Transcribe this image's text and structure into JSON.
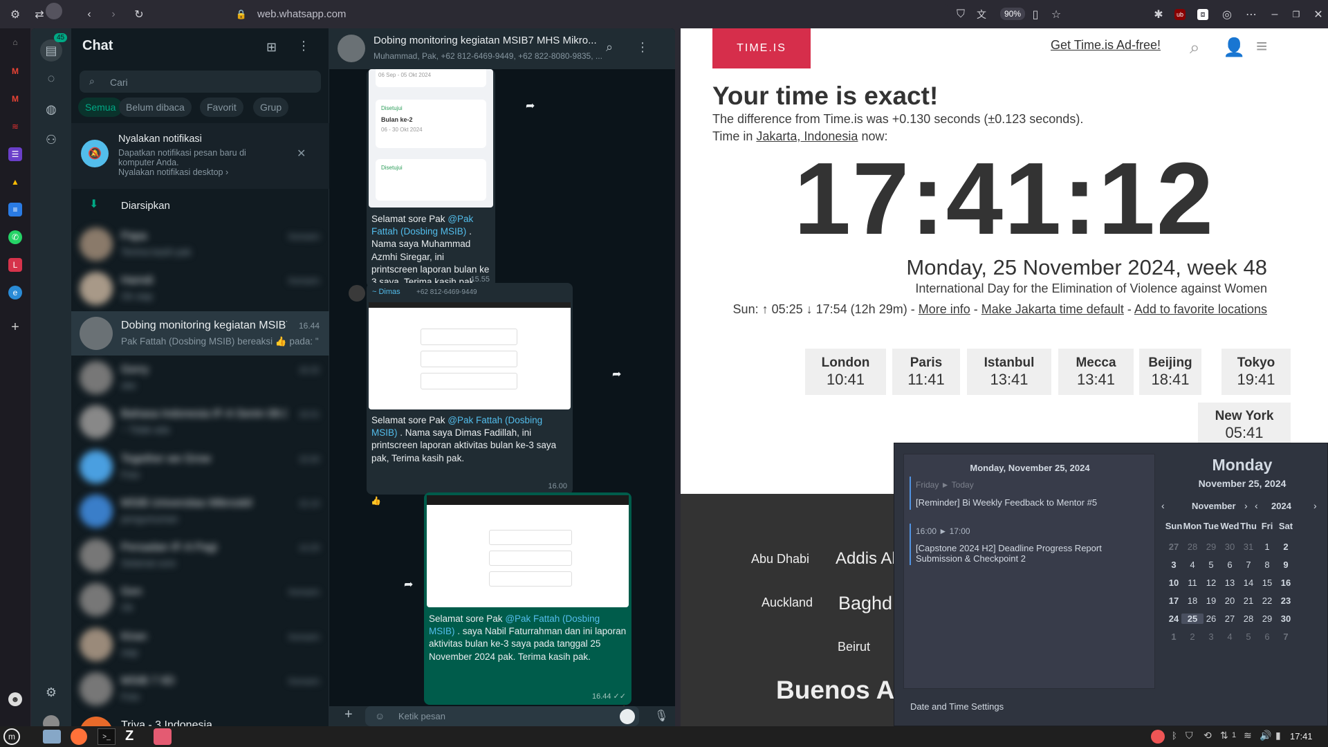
{
  "browser": {
    "url": "web.whatsapp.com",
    "zoom": "90%",
    "ublock": "ub"
  },
  "whatsapp": {
    "unread_badge": "45",
    "title": "Chat",
    "search_placeholder": "Cari",
    "filters": [
      "Semua",
      "Belum dibaca",
      "Favorit",
      "Grup"
    ],
    "notif": {
      "title": "Nyalakan notifikasi",
      "body": "Dapatkan notifikasi pesan baru di komputer Anda.",
      "link": "Nyalakan notifikasi desktop ›"
    },
    "archived": "Diarsipkan",
    "chats": [
      {
        "name": "Papa",
        "preview": "Terima kasih pak",
        "time": "Kemarin",
        "blurred": true
      },
      {
        "name": "Hamdi",
        "preview": "Ok siap",
        "time": "Kemarin",
        "blurred": true
      },
      {
        "name": "Dobing monitoring kegiatan MSIB7 ...",
        "preview": "Pak Fattah (Dosbing MSIB) bereaksi 👍 pada: \"📷 S",
        "time": "16.44",
        "blurred": false
      },
      {
        "name": "Gerry",
        "preview": "oke",
        "time": "16.32",
        "blurred": true
      },
      {
        "name": "Bahasa Indonesia IF-A Senin 08.00 ...",
        "preview": "~ Tidak ada",
        "time": "16.01",
        "blurred": true
      },
      {
        "name": "Together we Grow",
        "preview": "Foto",
        "time": "15.50",
        "blurred": true
      },
      {
        "name": "MSIB Universitas Mikroskil",
        "preview": "pengumuman",
        "time": "15.10",
        "blurred": true
      },
      {
        "name": "Persadan IF-A Pagi",
        "preview": "Selamat sore",
        "time": "14.20",
        "blurred": true
      },
      {
        "name": "Gen",
        "preview": "Ok",
        "time": "Kemarin",
        "blurred": true
      },
      {
        "name": "Kiran",
        "preview": "siap",
        "time": "Kemarin",
        "blurred": true
      },
      {
        "name": "MSIB 7 IID",
        "preview": "Foto",
        "time": "Kemarin",
        "blurred": true
      },
      {
        "name": "Triya - 3 Indonesia",
        "preview": "",
        "time": "",
        "blurred": false
      }
    ],
    "conversation": {
      "title": "Dobing monitoring kegiatan MSIB7 MHS Mikro...",
      "members": "Muhammad, Pak, +62 812-6469-9449, +62 822-8080-9835, ...",
      "messages": [
        {
          "text_pre": "Selamat sore Pak ",
          "mention": "@Pak Fattah (Dosbing MSIB)",
          "text_post": " . Nama saya Muhammad Azmhi Siregar, ini printscreen laporan bulan ke 3 saya. Terima kasih pak",
          "time": "15.55",
          "reaction": "👍"
        },
        {
          "sender": "~ Dimas",
          "phone": "+62 812-6469-9449",
          "text_pre": "Selamat sore Pak ",
          "mention": "@Pak Fattah (Dosbing MSIB)",
          "text_post": " . Nama saya Dimas Fadillah, ini printscreen laporan aktivitas bulan ke-3 saya pak, Terima kasih pak.",
          "time": "16.00",
          "reaction": "👍"
        },
        {
          "text_pre": "Selamat sore Pak ",
          "mention": "@Pak Fattah (Dosbing MSIB)",
          "text_post": " . saya Nabil Faturrahman dan ini laporan aktivitas bulan ke-3 saya pada tanggal 25 November 2024 pak. Terima kasih pak.",
          "time": "16.44 ✓✓",
          "reaction": "👍"
        }
      ],
      "shot_labels": {
        "approved": "Disetujui",
        "month2": "Bulan ke-2",
        "month2_dates": "06 - 30 Okt 2024",
        "month1_dates": "06 Sep - 05 Okt 2024"
      },
      "compose_placeholder": "Ketik pesan"
    }
  },
  "timeis": {
    "logo": "TIME.IS",
    "adfree": "Get Time.is Ad-free!",
    "headline": "Your time is exact!",
    "diff": "The difference from Time.is was +0.130 seconds (±0.123 seconds).",
    "loc_pre": "Time in ",
    "loc": "Jakarta, Indonesia",
    "loc_post": " now:",
    "clock": "17:41:12",
    "date": "Monday, 25 November 2024, week 48",
    "observance": "International Day for the Elimination of Violence against Women",
    "sun": "Sun: ↑ 05:25 ↓ 17:54 (12h 29m) - ",
    "more": "More info",
    "make_default": "Make Jakarta time default",
    "fav": "Add to favorite locations",
    "cities": [
      {
        "n": "London",
        "t": "10:41"
      },
      {
        "n": "Paris",
        "t": "11:41"
      },
      {
        "n": "Istanbul",
        "t": "13:41"
      },
      {
        "n": "Mecca",
        "t": "13:41"
      },
      {
        "n": "Beijing",
        "t": "18:41"
      },
      {
        "n": "Tokyo",
        "t": "19:41"
      },
      {
        "n": "New York",
        "t": "05:41"
      }
    ],
    "world": [
      "Abu Dhabi",
      "Addis Ab",
      "Auckland",
      "Baghd",
      "Beirut",
      "Buenos A"
    ]
  },
  "calendar": {
    "events_date": "Monday, November 25, 2024",
    "e1_range": "Friday ► Today",
    "e1": "[Reminder] Bi Weekly Feedback to Mentor #5",
    "e2_range": "16:00 ► 17:00",
    "e2": "[Capstone 2024 H2] Deadline Progress Report Submission & Checkpoint 2",
    "settings": "Date and Time Settings",
    "day": "Monday",
    "full": "November 25, 2024",
    "month": "November",
    "year": "2024",
    "weekdays": [
      "Sun",
      "Mon",
      "Tue",
      "Wed",
      "Thu",
      "Fri",
      "Sat"
    ],
    "weeks": [
      [
        "27",
        "28",
        "29",
        "30",
        "31",
        "1",
        "2"
      ],
      [
        "3",
        "4",
        "5",
        "6",
        "7",
        "8",
        "9"
      ],
      [
        "10",
        "11",
        "12",
        "13",
        "14",
        "15",
        "16"
      ],
      [
        "17",
        "18",
        "19",
        "20",
        "21",
        "22",
        "23"
      ],
      [
        "24",
        "25",
        "26",
        "27",
        "28",
        "29",
        "30"
      ],
      [
        "1",
        "2",
        "3",
        "4",
        "5",
        "6",
        "7"
      ]
    ]
  },
  "taskbar": {
    "clock": "17:41",
    "wifi_count": "1"
  }
}
